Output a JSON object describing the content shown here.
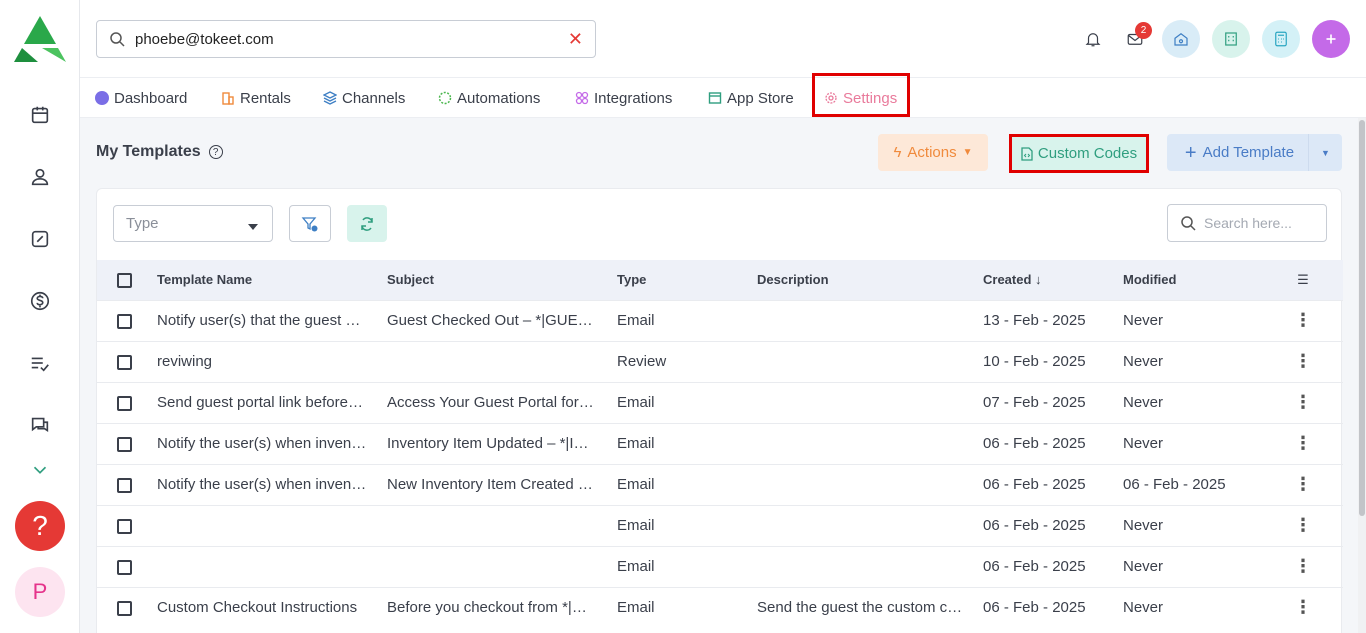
{
  "search": {
    "value": "phoebe@tokeet.com"
  },
  "notifications": {
    "mail_badge": "2"
  },
  "nav": {
    "tabs": [
      {
        "label": "Dashboard",
        "icon": "dashboard-icon"
      },
      {
        "label": "Rentals",
        "icon": "rentals-icon"
      },
      {
        "label": "Channels",
        "icon": "channels-icon"
      },
      {
        "label": "Automations",
        "icon": "automations-icon"
      },
      {
        "label": "Integrations",
        "icon": "integrations-icon"
      },
      {
        "label": "App Store",
        "icon": "app-store-icon"
      },
      {
        "label": "Settings",
        "icon": "gear-icon"
      }
    ]
  },
  "page": {
    "title": "My Templates",
    "actions_label": "Actions",
    "custom_codes_label": "Custom Codes",
    "add_template_label": "Add Template"
  },
  "filters": {
    "type_placeholder": "Type",
    "search_placeholder": "Search here..."
  },
  "table": {
    "columns": [
      "Template Name",
      "Subject",
      "Type",
      "Description",
      "Created",
      "Modified"
    ],
    "rows": [
      {
        "name": "Notify user(s) that the guest has checked out",
        "subject": "Guest Checked Out – *|GUEST:NAME|*",
        "type": "Email",
        "description": "",
        "created": "13 - Feb - 2025",
        "modified": "Never"
      },
      {
        "name": "reviwing",
        "subject": "",
        "type": "Review",
        "description": "",
        "created": "10 - Feb - 2025",
        "modified": "Never"
      },
      {
        "name": "Send guest portal link before arrival",
        "subject": "Access Your Guest Portal for your stay",
        "type": "Email",
        "description": "",
        "created": "07 - Feb - 2025",
        "modified": "Never"
      },
      {
        "name": "Notify the user(s) when inventory item is updated",
        "subject": "Inventory Item Updated – *|ITEM|*",
        "type": "Email",
        "description": "",
        "created": "06 - Feb - 2025",
        "modified": "Never"
      },
      {
        "name": "Notify the user(s) when inventory item is created",
        "subject": "New Inventory Item Created – *|ITEM|*",
        "type": "Email",
        "description": "",
        "created": "06 - Feb - 2025",
        "modified": "06 - Feb - 2025"
      },
      {
        "name": "",
        "subject": "",
        "type": "Email",
        "description": "",
        "created": "06 - Feb - 2025",
        "modified": "Never"
      },
      {
        "name": "",
        "subject": "",
        "type": "Email",
        "description": "",
        "created": "06 - Feb - 2025",
        "modified": "Never"
      },
      {
        "name": "Custom Checkout Instructions",
        "subject": "Before you checkout from *|RENTAL:NAME|*",
        "type": "Email",
        "description": "Send the guest the custom checkout instructions",
        "created": "06 - Feb - 2025",
        "modified": "Never"
      }
    ]
  },
  "user": {
    "initial": "P"
  },
  "colors": {
    "accent": "#4a7cc6",
    "danger": "#e53935",
    "success": "#2f9e7f",
    "warning": "#f08a3c"
  }
}
